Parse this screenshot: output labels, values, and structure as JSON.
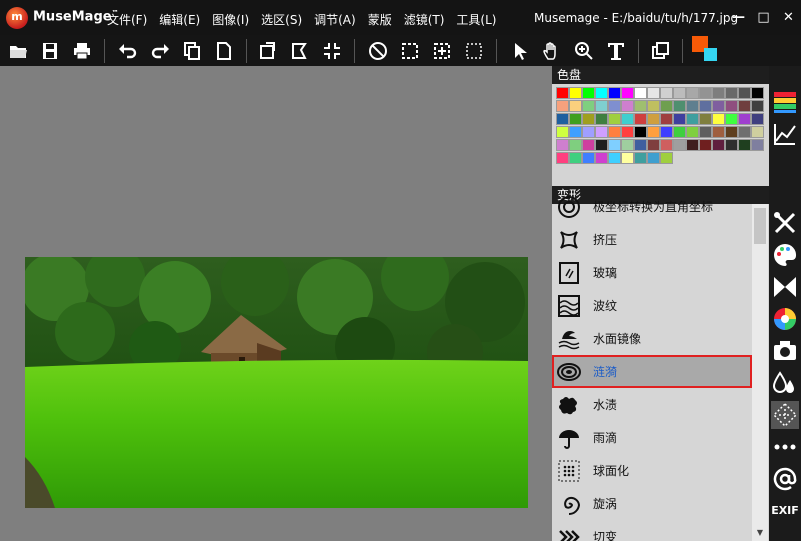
{
  "app": {
    "logo_letter": "m",
    "name": "MuseMage",
    "trademark": "™",
    "window_title": "Musemage - E:/baidu/tu/h/177.jpg"
  },
  "menu": [
    "文件(F)",
    "编辑(E)",
    "图像(I)",
    "选区(S)",
    "调节(A)",
    "蒙版",
    "滤镜(T)",
    "工具(L)"
  ],
  "window_controls": {
    "minimize": "—",
    "maximize": "□",
    "close": "✕"
  },
  "colors": {
    "foreground": "#f75a07",
    "background": "#35d6f2",
    "selection_outline": "#e02020",
    "selected_text": "#1d5dc7"
  },
  "palette_panel": {
    "title": "色盘",
    "swatches": [
      "#ff0000",
      "#ffff00",
      "#00ff00",
      "#00ffff",
      "#0000ff",
      "#ff00ff",
      "#ffffff",
      "#e6e6e6",
      "#d0d0d0",
      "#bcbcbc",
      "#a8a8a8",
      "#939393",
      "#7e7e7e",
      "#696969",
      "#545454",
      "#000000",
      "#f7a17d",
      "#fbd07d",
      "#7fcf7f",
      "#7fcfcf",
      "#7f8fd0",
      "#cf7fcf",
      "#9fbf6f",
      "#bfbf5f",
      "#6f9f4f",
      "#4f8f6f",
      "#5f7f8f",
      "#5f6f9f",
      "#7f5f9f",
      "#8f4f7f",
      "#6f3f3f",
      "#3f3f3f",
      "#1f5f9f",
      "#3f9f1f",
      "#9f9f1f",
      "#3f7f3f",
      "#9fcf3f",
      "#3fcfcf",
      "#cf3f3f",
      "#cf9f3f",
      "#9f3f3f",
      "#3f3f9f",
      "#3f9f9f",
      "#7f7f3f",
      "#ffff3f",
      "#3fff3f",
      "#9f3fcf",
      "#3f3f7f",
      "#cfff3f",
      "#3f9fff",
      "#9f9fff",
      "#cf9fff",
      "#ff7f3f",
      "#ff3f3f",
      "#000000",
      "#ff9f3f",
      "#3f3fff",
      "#3fcf3f",
      "#7fcf3f",
      "#5f5f5f",
      "#9f5f3f",
      "#5f3f1f",
      "#6f6f6f",
      "#cfcf9f",
      "#cf7fcf",
      "#7fcf7f",
      "#cf3f9f",
      "#1f1f1f",
      "#7fcfff",
      "#9fcf9f",
      "#3f5f9f",
      "#7f3f3f",
      "#cf5f5f",
      "#9f9f9f",
      "#3f1f1f",
      "#6f1f1f",
      "#5f1f3f",
      "#2f2f2f",
      "#1f3f1f",
      "#7f7f9f",
      "#ff3f7f",
      "#3fcf7f",
      "#3f7fff",
      "#cf3fcf",
      "#3fcfff",
      "#ffff9f",
      "#3f9f9f",
      "#3f9fcf",
      "#9fcf3f"
    ]
  },
  "transform_panel": {
    "title": "变形",
    "items": [
      {
        "label": "极坐标转换为直角坐标",
        "icon": "polar-rect-icon"
      },
      {
        "label": "挤压",
        "icon": "pinch-icon"
      },
      {
        "label": "玻璃",
        "icon": "glass-icon"
      },
      {
        "label": "波纹",
        "icon": "ripple-icon"
      },
      {
        "label": "水面镜像",
        "icon": "water-mirror-icon"
      },
      {
        "label": "涟漪",
        "icon": "ripple-rings-icon",
        "selected": true
      },
      {
        "label": "水渍",
        "icon": "water-stain-icon"
      },
      {
        "label": "雨滴",
        "icon": "umbrella-icon"
      },
      {
        "label": "球面化",
        "icon": "spherize-icon"
      },
      {
        "label": "旋涡",
        "icon": "twirl-icon"
      },
      {
        "label": "切变",
        "icon": "shear-icon"
      }
    ]
  },
  "side_strip": {
    "exif_label": "EXIF"
  },
  "toolbar": [
    "open-icon",
    "save-icon",
    "print-icon",
    "undo-icon",
    "redo-icon",
    "copy-icon",
    "paste-icon",
    "rotate-icon",
    "crop-icon",
    "resize-icon",
    "deselect-icon",
    "select-rect-icon",
    "select-add-icon",
    "select-icon",
    "pointer-icon",
    "hand-icon",
    "zoom-icon",
    "text-icon",
    "layers-icon"
  ]
}
